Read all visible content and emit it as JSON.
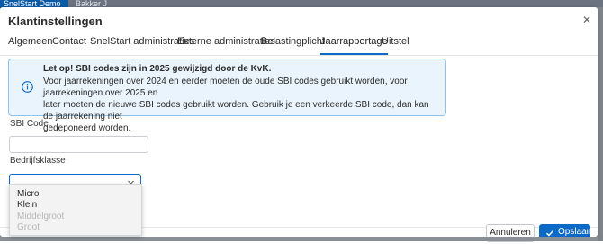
{
  "app": {
    "brand": "SnelStart Demo",
    "tab_title": "Bakker J"
  },
  "modal": {
    "title": "Klantinstellingen",
    "close_icon": "close-icon"
  },
  "tabs": [
    {
      "label": "Algemeen",
      "active": false
    },
    {
      "label": "Contact",
      "active": false
    },
    {
      "label": "SnelStart administraties",
      "active": false
    },
    {
      "label": "Externe administraties",
      "active": false
    },
    {
      "label": "Belastingplicht",
      "active": false
    },
    {
      "label": "Jaarrapportage",
      "active": true
    },
    {
      "label": "Uitstel",
      "active": false
    }
  ],
  "notice": {
    "icon": "info-icon",
    "title": "Let op! SBI codes zijn in 2025 gewijzigd door de KvK.",
    "lines": [
      "Voor jaarrekeningen over 2024 en eerder moeten de oude SBI codes gebruikt worden, voor jaarrekeningen over 2025 en",
      "later moeten de nieuwe SBI codes gebruikt worden. Gebruik je een verkeerde SBI code, dan kan de jaarrekening niet",
      "gedeponeerd worden."
    ],
    "colors": {
      "background": "#eaf4fc",
      "border": "#8ec2ea",
      "icon": "#0b69c7"
    }
  },
  "form": {
    "sbi_code": {
      "label": "SBI Code",
      "value": ""
    },
    "bedrijfsklasse": {
      "label": "Bedrijfsklasse",
      "value": "",
      "options": [
        {
          "label": "Micro",
          "enabled": true
        },
        {
          "label": "Klein",
          "enabled": true
        },
        {
          "label": "Middelgroot",
          "enabled": false
        },
        {
          "label": "Groot",
          "enabled": false
        }
      ]
    }
  },
  "footer": {
    "cancel_label": "Annuleren",
    "save_label": "Opslaan",
    "save_icon": "check-icon"
  },
  "colors": {
    "accent": "#0b69c7",
    "disabled_text": "#b4b6b9"
  }
}
